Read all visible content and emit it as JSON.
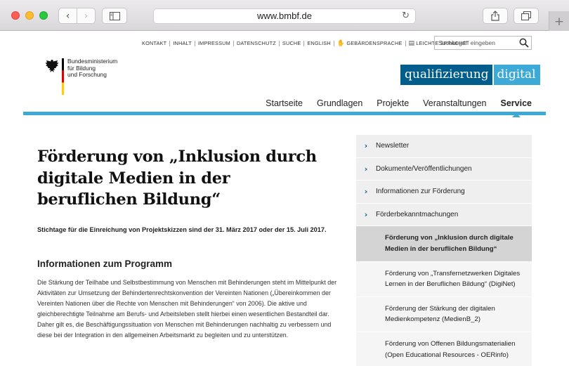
{
  "browser": {
    "url": "www.bmbf.de",
    "icons": {
      "back": "chevron-left-icon",
      "forward": "chevron-right-icon",
      "sidebar": "sidebar-icon",
      "reload": "reload-icon",
      "share": "share-icon",
      "tabs": "tabs-icon",
      "new_tab": "plus-icon"
    },
    "back_glyph": "‹",
    "forward_glyph": "›",
    "new_tab_glyph": "+",
    "reload_glyph": "↻"
  },
  "service_links": [
    "KONTAKT",
    "INHALT",
    "IMPRESSUM",
    "DATENSCHUTZ",
    "SUCHE",
    "ENGLISH",
    "GEBÄRDENSPRACHE",
    "LEICHTE SPRACHE"
  ],
  "search": {
    "placeholder": "Suchbegriff eingeben"
  },
  "logo": {
    "line1": "Bundesministerium",
    "line2": "für Bildung",
    "line3": "und Forschung"
  },
  "brand": {
    "part1": "qualifizierung",
    "part2": "digital"
  },
  "main_nav": {
    "items": [
      "Startseite",
      "Grundlagen",
      "Projekte",
      "Veranstaltungen",
      "Service"
    ],
    "active": "Service"
  },
  "article": {
    "title": "Förderung von „Inklusion durch digitale Medien in der beruflichen Bildung“",
    "intro": "Stichtage für die Einreichung von Projektskizzen sind der 31. März 2017 oder der 15. Juli 2017.",
    "section_heading": "Informationen zum Programm",
    "paragraph": "Die Stärkung der Teilhabe und Selbstbestimmung von Menschen mit Behinderungen steht im Mittelpunkt der Aktivitäten zur Umsetzung der Behindertenrechtskonvention der Vereinten Nationen („Übereinkommen der Vereinten Nationen über die Rechte von Menschen mit Behinderungen“ von 2006). Die aktive und gleichberechtigte Teilnahme am Berufs- und Arbeitsleben stellt hierbei einen wesentlichen Bestandteil dar. Daher gilt es, die Beschäftigungssituation von Menschen mit Behinderungen nachhaltig zu verbessern und diese bei der Integration in den allgemeinen Arbeitsmarkt zu begleiten und zu unterstützen."
  },
  "sidebar": {
    "items": [
      "Newsletter",
      "Dokumente/Veröffentlichungen",
      "Informationen zur Förderung",
      "Förderbekanntmachungen"
    ],
    "sub_items": [
      "Förderung von „Inklusion durch digitale Medien in der beruflichen Bildung“",
      "Förderung von „Transfernetzwerken Digitales Lernen in der Beruflichen Bildung“ (DigiNet)",
      "Förderung der Stärkung der digitalen Medienkompetenz (MedienB_2)",
      "Förderung von Offenen Bildungsmaterialien (Open Educational Resources - OERinfo)"
    ],
    "chevron_glyph": "›"
  },
  "colors": {
    "accent_blue": "#3ca9d6",
    "brand_dark": "#005d8c",
    "sidebar_bg": "#efefef",
    "sidebar_active": "#d4d4d4"
  }
}
